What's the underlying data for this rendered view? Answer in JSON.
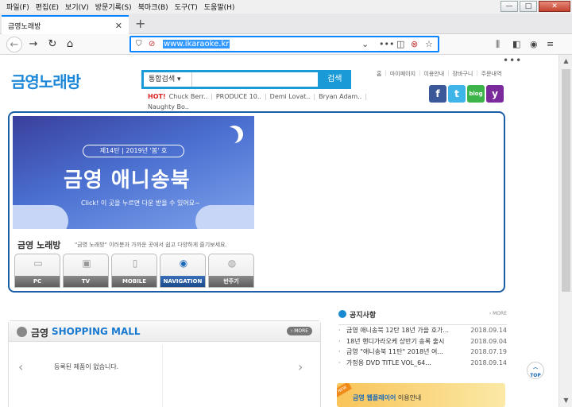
{
  "menu": [
    "파일(F)",
    "편집(E)",
    "보기(V)",
    "방문기록(S)",
    "북마크(B)",
    "도구(T)",
    "도움말(H)"
  ],
  "window_controls": {
    "minimize": "—",
    "maximize": "□",
    "close": "✕"
  },
  "tab": {
    "title": "금영노래방",
    "close": "✕",
    "new_tab": "+"
  },
  "url": "www.ikaraoke.kr",
  "site": {
    "logo": "금영노래방",
    "dots": "•••",
    "search": {
      "category": "통합검색",
      "button": "검색",
      "placeholder": ""
    },
    "hot": {
      "label": "HOT!",
      "items": [
        "Chuck Berr..",
        "PRODUCE 10..",
        "Demi Lovat..",
        "Bryan Adam..",
        "Naughty Bo.."
      ]
    },
    "top_links": [
      "홈",
      "마이페이지",
      "이용안내",
      "장바구니",
      "주문내역"
    ],
    "social": [
      "f",
      "t",
      "blog",
      "y"
    ],
    "banner": {
      "issue": "제14탄 | 2019년 '봄' 호",
      "title": "금영 애니송북",
      "subtitle": "Click! 이 곳을 누르면 다운 받을 수 있어요~"
    },
    "norae": {
      "title": "금영 노래방",
      "desc": "\"금영 노래방\" 이러분과 가까운 곳에서 쉽고 다양하게 즐기보세요."
    },
    "devices": [
      {
        "label": "PC",
        "icon": "▭"
      },
      {
        "label": "TV",
        "icon": "▣"
      },
      {
        "label": "MOBILE",
        "icon": "▯"
      },
      {
        "label": "NAVIGATION",
        "icon": "◉"
      },
      {
        "label": "반주기",
        "icon": "◍"
      }
    ],
    "mall": {
      "prefix": "금영",
      "title": "SHOPPING MALL",
      "more": "› MORE",
      "empty": "등록된 제품이 없습니다."
    },
    "notice": {
      "title": "공지사항",
      "more": "› MORE",
      "items": [
        {
          "text": "금영 애니송북 12탄 18년 가을 호가...",
          "date": "2018.09.14"
        },
        {
          "text": "18년 핸디가라오케 상반기 송록 출시",
          "date": "2018.09.04"
        },
        {
          "text": "금영 \"애니송북 11탄\" 2018년 여...",
          "date": "2018.07.19"
        },
        {
          "text": "가정용 DVD TITLE VOL_64...",
          "date": "2018.09.14"
        }
      ]
    },
    "wplayer": {
      "prefix": "금영 웹플레이어",
      "suffix": " 이용안내",
      "badge": "NEW"
    },
    "top_button": "TOP"
  }
}
